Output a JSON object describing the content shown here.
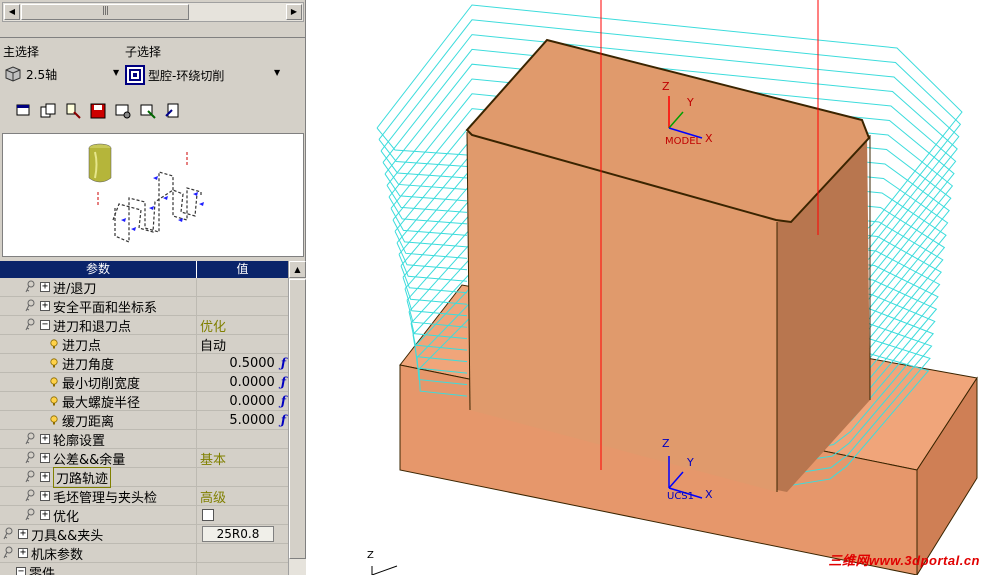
{
  "selection": {
    "main_label": "主选择",
    "main_value": "2.5轴",
    "sub_label": "子选择",
    "sub_value": "型腔-环绕切削"
  },
  "toolbar_icons": [
    "window-icon",
    "copy-icon",
    "tool-icon",
    "save-icon",
    "settings-icon",
    "wizard-icon",
    "report-icon"
  ],
  "grid": {
    "col_param": "参数",
    "col_value": "值",
    "rows": [
      {
        "indent": 1,
        "icon": "key",
        "expander": "+",
        "label": "进/退刀",
        "value": "",
        "num": false
      },
      {
        "indent": 1,
        "icon": "key",
        "expander": "+",
        "label": "安全平面和坐标系",
        "value": "",
        "num": false
      },
      {
        "indent": 1,
        "icon": "key",
        "expander": "−",
        "label": "进刀和退刀点",
        "value": "优化",
        "valueStyle": "olive",
        "num": false
      },
      {
        "indent": 2,
        "icon": "bulb",
        "expander": "",
        "label": "进刀点",
        "value": "自动",
        "num": false
      },
      {
        "indent": 2,
        "icon": "bulb",
        "expander": "",
        "label": "进刀角度",
        "value": "0.5000",
        "num": true
      },
      {
        "indent": 2,
        "icon": "bulb",
        "expander": "",
        "label": "最小切削宽度",
        "value": "0.0000",
        "num": true
      },
      {
        "indent": 2,
        "icon": "bulb",
        "expander": "",
        "label": "最大螺旋半径",
        "value": "0.0000",
        "num": true
      },
      {
        "indent": 2,
        "icon": "bulb",
        "expander": "",
        "label": "缓刀距离",
        "value": "5.0000",
        "num": true
      },
      {
        "indent": 1,
        "icon": "key",
        "expander": "+",
        "label": "轮廓设置",
        "value": "",
        "num": false
      },
      {
        "indent": 1,
        "icon": "key",
        "expander": "+",
        "label": "公差&&余量",
        "value": "基本",
        "valueStyle": "olive",
        "num": false
      },
      {
        "indent": 1,
        "icon": "key",
        "expander": "+",
        "label": "刀路轨迹",
        "value": "",
        "num": false,
        "highlight": true
      },
      {
        "indent": 1,
        "icon": "key",
        "expander": "+",
        "label": "毛坯管理与夹头检",
        "value": "高级",
        "valueStyle": "olive",
        "num": false
      },
      {
        "indent": 1,
        "icon": "key",
        "expander": "+",
        "label": "优化",
        "value": "",
        "num": false,
        "checkbox": true
      },
      {
        "indent": 0,
        "icon": "key",
        "expander": "+",
        "label": "刀具&&夹头",
        "value": "25R0.8",
        "num": false,
        "toolbox": true
      },
      {
        "indent": 0,
        "icon": "key",
        "expander": "+",
        "label": "机床参数",
        "value": "",
        "num": false
      },
      {
        "indent": 0,
        "icon": "none",
        "expander": "−",
        "label": "零件",
        "value": "",
        "num": false
      }
    ]
  },
  "viewport": {
    "model_axis": {
      "z": "Z",
      "y": "Y",
      "x": "X",
      "name": "MODEL"
    },
    "ucs_axis": {
      "z": "Z",
      "y": "Y",
      "x": "X",
      "name": "UCS1"
    },
    "corner_axis": "Z",
    "watermark": "三维网www.3dportal.cn",
    "colors": {
      "part": "#e09a6c",
      "toolpath": "#3cdcdc",
      "edge": "#3a2400",
      "axis": "#ff0000"
    }
  }
}
